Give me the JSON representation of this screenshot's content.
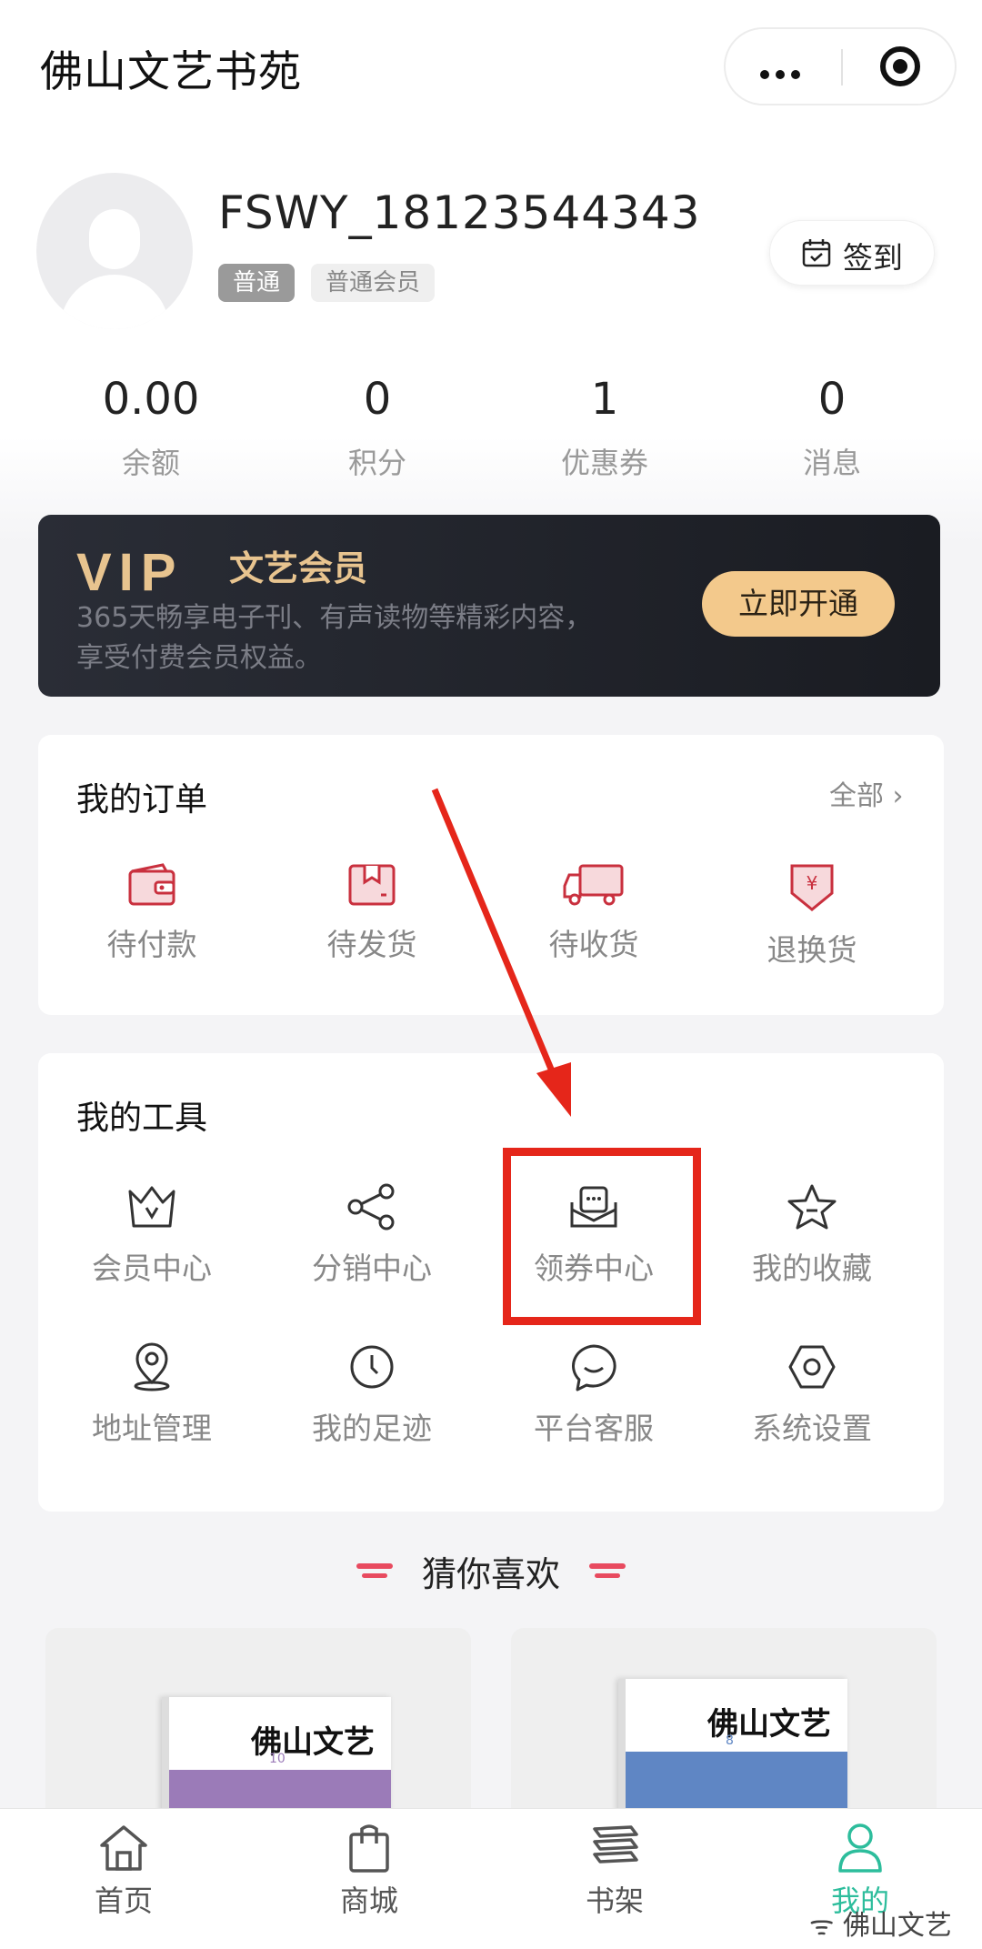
{
  "header": {
    "title": "佛山文艺书苑"
  },
  "profile": {
    "username": "FSWY_18123544343",
    "badge_level": "普通",
    "badge_member": "普通会员",
    "checkin_label": "签到"
  },
  "stats": [
    {
      "value": "0.00",
      "label": "余额"
    },
    {
      "value": "0",
      "label": "积分"
    },
    {
      "value": "1",
      "label": "优惠券"
    },
    {
      "value": "0",
      "label": "消息"
    }
  ],
  "vip": {
    "logo": "VIP",
    "title": "文艺会员",
    "desc_line1": "365天畅享电子刊、有声读物等精彩内容，",
    "desc_line2": "享受付费会员权益。",
    "button": "立即开通"
  },
  "orders": {
    "title": "我的订单",
    "more": "全部",
    "items": [
      {
        "label": "待付款",
        "icon": "wallet-icon"
      },
      {
        "label": "待发货",
        "icon": "package-icon"
      },
      {
        "label": "待收货",
        "icon": "truck-icon"
      },
      {
        "label": "退换货",
        "icon": "refund-icon"
      }
    ]
  },
  "tools": {
    "title": "我的工具",
    "items": [
      {
        "label": "会员中心",
        "icon": "crown-icon"
      },
      {
        "label": "分销中心",
        "icon": "share-icon"
      },
      {
        "label": "领券中心",
        "icon": "coupon-envelope-icon"
      },
      {
        "label": "我的收藏",
        "icon": "star-icon"
      },
      {
        "label": "地址管理",
        "icon": "location-pin-icon"
      },
      {
        "label": "我的足迹",
        "icon": "clock-icon"
      },
      {
        "label": "平台客服",
        "icon": "chat-bubble-icon"
      },
      {
        "label": "系统设置",
        "icon": "hexagon-settings-icon"
      }
    ]
  },
  "recommend": {
    "title": "猜你喜欢",
    "products": [
      {
        "cover_title": "佛山文艺",
        "issue": "10",
        "cover_color": "#9b7bb8"
      },
      {
        "cover_title": "佛山文艺",
        "issue": "8",
        "cover_color": "#5f86c4"
      }
    ]
  },
  "tabbar": {
    "items": [
      {
        "label": "首页",
        "icon": "home-icon"
      },
      {
        "label": "商城",
        "icon": "shopping-bag-icon"
      },
      {
        "label": "书架",
        "icon": "bookshelf-icon"
      },
      {
        "label": "我的",
        "icon": "user-icon"
      }
    ],
    "active": "我的",
    "active_color": "#2dbd9c"
  },
  "watermark": "佛山文艺",
  "colors": {
    "accent_red": "#c9303e",
    "vip_gold": "#e8c48f",
    "highlight": "#e5261a"
  }
}
